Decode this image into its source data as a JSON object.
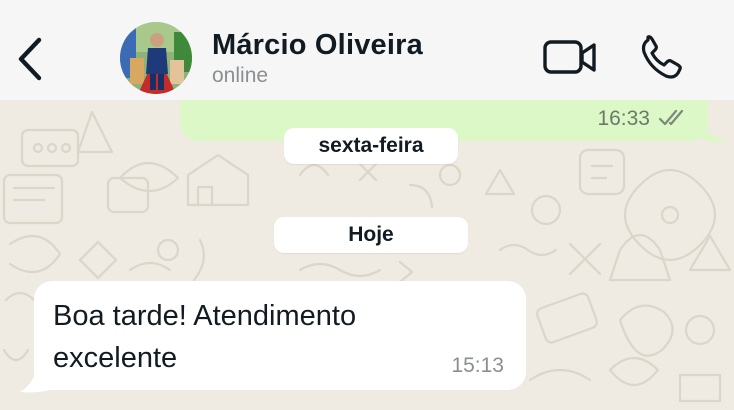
{
  "header": {
    "contact_name": "Márcio Oliveira",
    "status": "online",
    "icons": [
      "back-chevron-icon",
      "avatar",
      "video-camera-icon",
      "phone-icon"
    ]
  },
  "messages": {
    "outgoing_previous": {
      "time": "16:33",
      "read_receipt": "double-check-icon"
    },
    "date_separators": [
      "sexta-feira",
      "Hoje"
    ],
    "incoming": {
      "text": "Boa tarde! Atendimento excelente",
      "time": "15:13"
    }
  },
  "colors": {
    "chat_background": "#efeae2",
    "header_background": "#f6f6f6",
    "outgoing_bubble": "#dcf8c6",
    "incoming_bubble": "#ffffff",
    "status_text": "#8a8f93"
  }
}
